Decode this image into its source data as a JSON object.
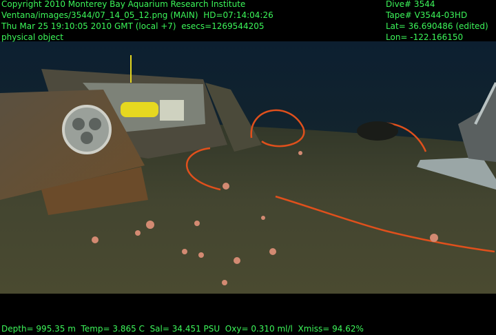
{
  "overlay": {
    "top_left": [
      "Copyright 2010 Monterey Bay Aquarium Research Institute",
      "Ventana/images/3544/07_14_05_12.png (MAIN)  HD=07:14:04:26",
      "Thu Mar 25 19:10:05 2010 GMT (local +7)  esecs=1269544205",
      "physical object"
    ],
    "top_right": [
      "Dive# 3544",
      "Tape# V3544-03HD",
      "Lat= 36.690486 (edited)",
      "Lon= -122.166150"
    ],
    "bottom": "Depth= 995.35 m  Temp= 3.865 C  Sal= 34.451 PSU  Oxy= 0.310 ml/l  Xmiss= 94.62%"
  },
  "colors": {
    "overlay_text": "#3cf65a",
    "water": "#0d2433",
    "seafloor": "#3e3f2a",
    "cable": "#e0501c",
    "housing_yellow": "#e6d820"
  }
}
